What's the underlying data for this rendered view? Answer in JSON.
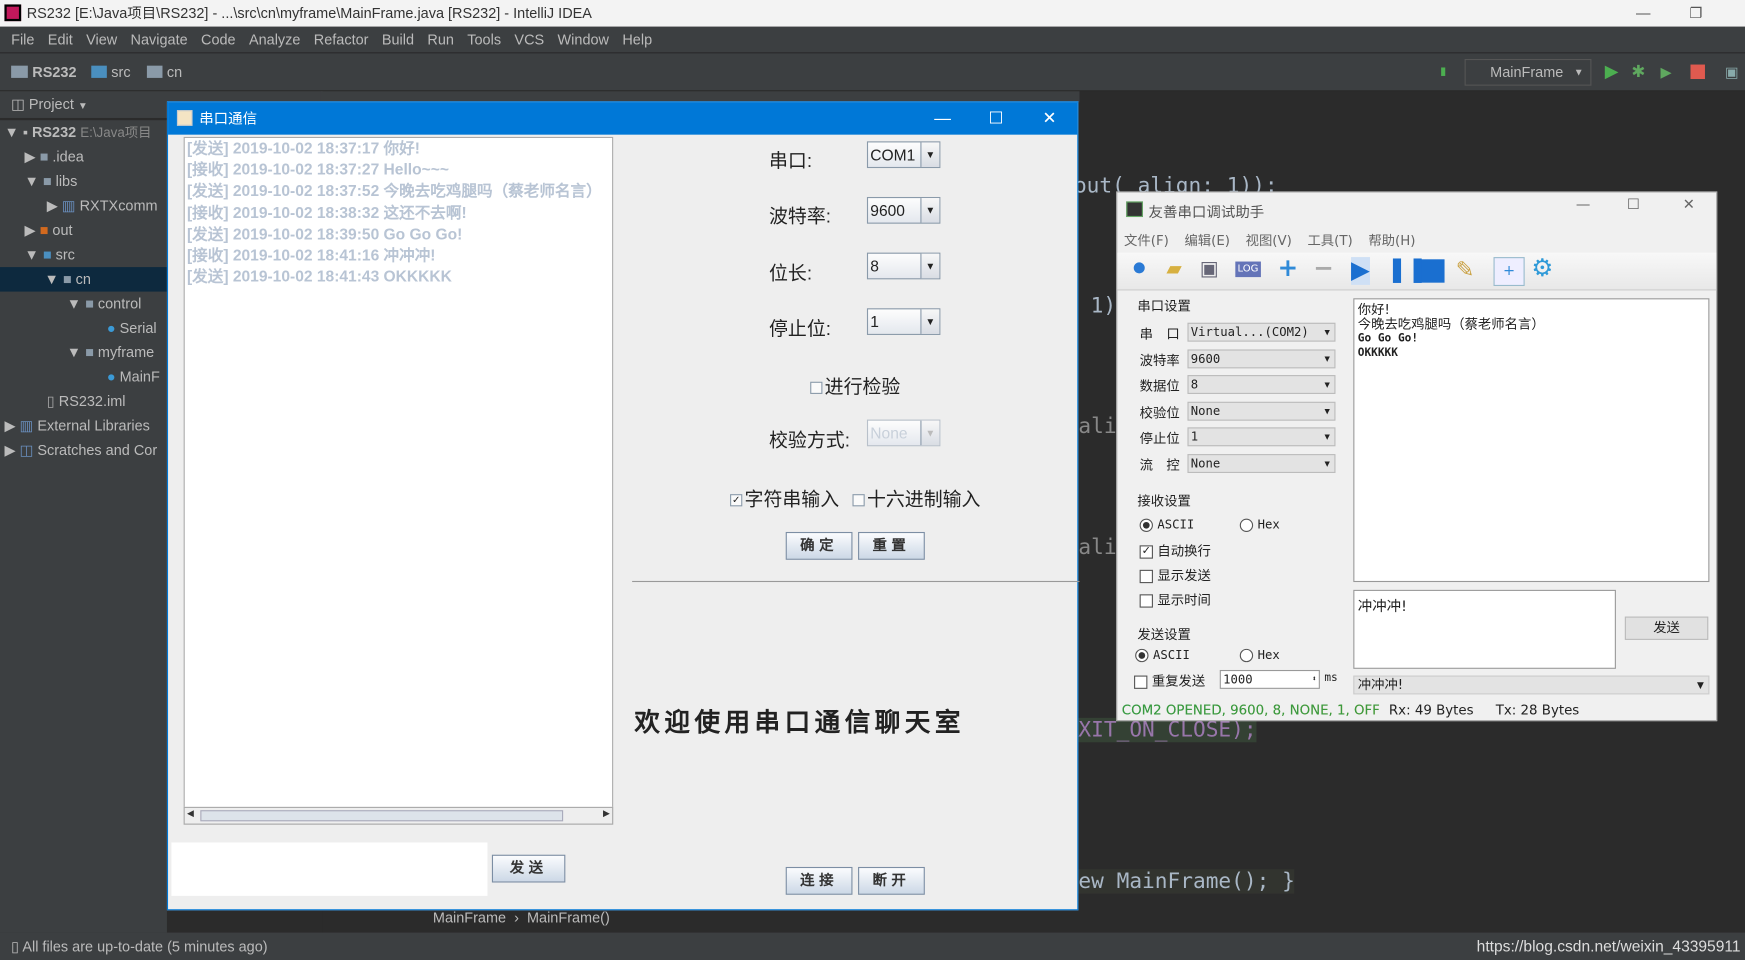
{
  "ide": {
    "window_title": "RS232 [E:\\Java项目\\RS232] - ...\\src\\cn\\myframe\\MainFrame.java [RS232] - IntelliJ IDEA",
    "menu": [
      "File",
      "Edit",
      "View",
      "Navigate",
      "Code",
      "Analyze",
      "Refactor",
      "Build",
      "Run",
      "Tools",
      "VCS",
      "Window",
      "Help"
    ],
    "breadcrumb": [
      "RS232",
      "src",
      "cn"
    ],
    "run_config": "MainFrame",
    "project_label": "Project",
    "tree": [
      {
        "label": "RS232",
        "extra": "E:\\Java项目"
      },
      {
        "label": ".idea"
      },
      {
        "label": "libs"
      },
      {
        "label": "RXTXcomm"
      },
      {
        "label": "out"
      },
      {
        "label": "src"
      },
      {
        "label": "cn"
      },
      {
        "label": "control"
      },
      {
        "label": "Serial"
      },
      {
        "label": "myframe"
      },
      {
        "label": "MainF"
      },
      {
        "label": "RS232.iml"
      },
      {
        "label": "External Libraries"
      },
      {
        "label": "Scratches and Cor"
      }
    ],
    "code_fragments": [
      "out( align: 1));",
      "1)",
      "alig",
      "alig",
      "XIT_ON_CLOSE);",
      "ew MainFrame(); }"
    ],
    "editor_breadcrumb": [
      "MainFrame",
      "MainFrame()"
    ],
    "status": "All files are up-to-date (5 minutes ago)",
    "watermark": "https://blog.csdn.net/weixin_43395911"
  },
  "serial_app": {
    "title": "串口通信",
    "log": [
      "[发送] 2019-10-02 18:37:17 你好!",
      "[接收] 2019-10-02 18:37:27 Hello~~~",
      "[发送] 2019-10-02 18:37:52 今晚去吃鸡腿吗（蔡老师名言）",
      "[接收] 2019-10-02 18:38:32 这还不去啊!",
      "[发送] 2019-10-02 18:39:50 Go Go Go!",
      "[接收] 2019-10-02 18:41:16 冲冲冲!",
      "[发送] 2019-10-02 18:41:43 OKKKKK"
    ],
    "input_value": "",
    "send": "发送",
    "port_label": "串口:",
    "port": "COM1",
    "baud_label": "波特率:",
    "baud": "9600",
    "bits_label": "位长:",
    "bits": "8",
    "stop_label": "停止位:",
    "stop": "1",
    "parity_check": "进行检验",
    "parity_checked": false,
    "parity_label": "校验方式:",
    "parity": "None",
    "string_input": "字符串输入",
    "string_checked": true,
    "hex_input": "十六进制输入",
    "hex_checked": false,
    "ok": "确定",
    "reset": "重置",
    "welcome": "欢迎使用串口通信聊天室",
    "connect": "连接",
    "disconnect": "断开"
  },
  "helper": {
    "title": "友善串口调试助手",
    "menu": [
      "文件(F)",
      "编辑(E)",
      "视图(V)",
      "工具(T)",
      "帮助(H)"
    ],
    "port_group": "串口设置",
    "fields": [
      {
        "label": "串　口",
        "value": "Virtual...(COM2)"
      },
      {
        "label": "波特率",
        "value": "9600"
      },
      {
        "label": "数据位",
        "value": "8"
      },
      {
        "label": "校验位",
        "value": "None"
      },
      {
        "label": "停止位",
        "value": "1"
      },
      {
        "label": "流　控",
        "value": "None"
      }
    ],
    "recv_group": "接收设置",
    "ascii": "ASCII",
    "hex": "Hex",
    "auto_wrap": "自动换行",
    "show_send": "显示发送",
    "show_time": "显示时间",
    "send_group": "发送设置",
    "repeat": "重复发送",
    "interval": "1000",
    "ms": "ms",
    "received": [
      "你好!",
      "今晚去吃鸡腿吗（蔡老师名言）",
      "Go Go Go!",
      "OKKKKK"
    ],
    "send_text": "冲冲冲!",
    "send_button": "发送",
    "history": "冲冲冲!",
    "status_port": "COM2 OPENED, 9600, 8, NONE, 1, OFF",
    "rx": "Rx: 49 Bytes",
    "tx": "Tx: 28 Bytes"
  }
}
